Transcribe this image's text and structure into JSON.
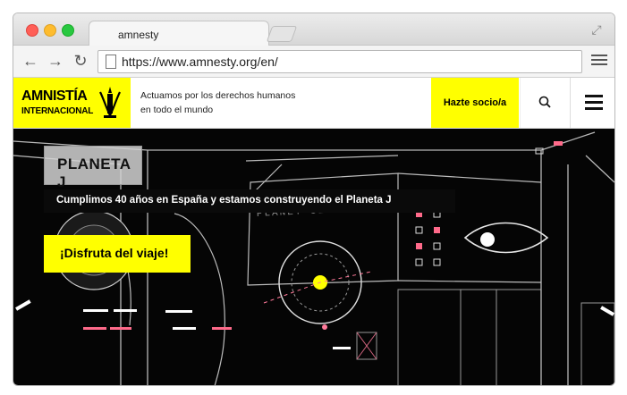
{
  "browser": {
    "tab_title": "amnesty",
    "url": "https://www.amnesty.org/en/",
    "traffic_lights": [
      "#ff5f57",
      "#febc2e",
      "#28c840"
    ]
  },
  "site": {
    "logo_line1": "AMNISTÍA",
    "logo_line2": "INTERNACIONAL",
    "tagline_line1": "Actuamos por los derechos humanos",
    "tagline_line2": "en todo el mundo",
    "join_label": "Hazte socio/a",
    "accent": "#ffff00"
  },
  "hero": {
    "title": "PLANETA J",
    "subtitle": "Cumplimos 40 años en España y estamos construyendo el Planeta J",
    "cta_label": "¡Disfruta del viaje!",
    "background_label": "PLANET SELECTION"
  }
}
